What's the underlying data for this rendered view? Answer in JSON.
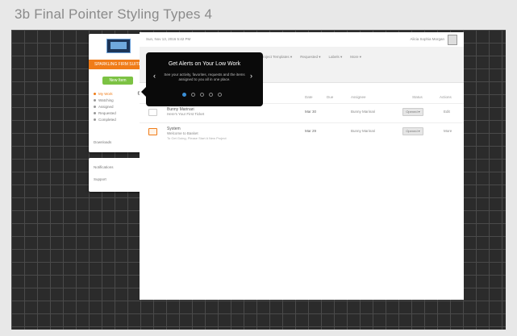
{
  "page": {
    "title": "3b Final Pointer Styling Types 4"
  },
  "sidebar": {
    "org_label": "SPARKLING FIRM SUITE",
    "new_button": "New Item",
    "nav_items": [
      {
        "label": "My Work",
        "active": true
      },
      {
        "label": "Watching",
        "active": false
      },
      {
        "label": "Assigned",
        "active": false
      },
      {
        "label": "Requested",
        "active": false
      },
      {
        "label": "Completed",
        "active": false
      }
    ],
    "downloads_label": "Downloads",
    "lower_links": [
      "Notifications",
      "Support"
    ]
  },
  "topbar": {
    "date": "Sun, Nov 13, 2016 5:42 PM",
    "user": "Alicia Sophia Morgan"
  },
  "filters": [
    "Project Templates ▾",
    "Requested ▾",
    "Labels ▾",
    "More ▾"
  ],
  "table": {
    "headers": [
      "Date",
      "Due",
      "Assignee",
      "Status",
      "Actions"
    ],
    "rows": [
      {
        "title": "Bunny Marinari",
        "subtitle": "Here's Your First Ticket",
        "note": "",
        "date": "Mar 30",
        "assignee": "Bunny Marinari",
        "status": "Opened ▾",
        "action": "Edit"
      },
      {
        "title": "System",
        "subtitle": "Welcome to Basket",
        "note": "To Get Going, Please Start A New Project",
        "date": "Mar 29",
        "assignee": "Bunny Marinari",
        "status": "Opened ▾",
        "action": "More"
      }
    ]
  },
  "pointer": {
    "title": "Get Alerts on Your Low Work",
    "body": "See your activity, favorites, requests and the items assigned to you all in one place.",
    "prev": "‹",
    "next": "›",
    "active_step": 1,
    "step_count": 5
  },
  "colors": {
    "accent": "#f07c18",
    "green": "#7cc243",
    "active_dot": "#3a8fd6"
  }
}
